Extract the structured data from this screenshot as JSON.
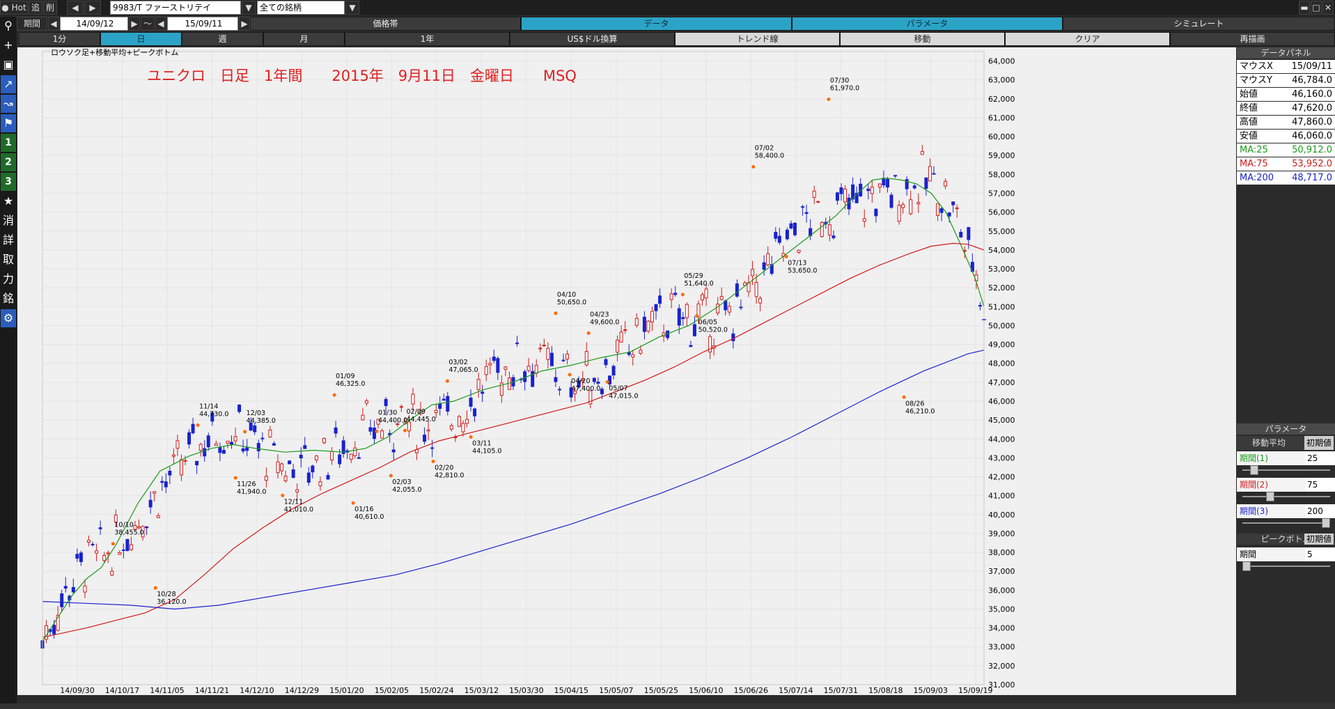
{
  "toolbar": {
    "hot_label": "Hot",
    "add_label": "追",
    "del_label": "削",
    "period_label": "期間",
    "ticker": "9983/T ファーストリテイ",
    "market": "全ての銘柄",
    "date_from": "14/09/12",
    "date_sep": "～",
    "date_to": "15/09/11",
    "tabs": [
      "価格帯",
      "データ",
      "パラメータ",
      "シミュレート"
    ],
    "timeframes": [
      "1分",
      "日",
      "週",
      "月",
      "1年",
      "US$ドル換算",
      "トレンド線",
      "移動",
      "クリア",
      "再描画"
    ]
  },
  "sidebar": {
    "items": [
      "+",
      "1",
      "2",
      "3",
      "★",
      "消",
      "詳",
      "取",
      "力",
      "銘"
    ]
  },
  "chart_data": {
    "type": "candlestick",
    "legend": "ロウソク足+移動平均+ピークボトム",
    "title": "ユニクロ　日足　1年間　　2015年　9月11日　金曜日　　MSQ",
    "ylim": [
      31000,
      64500
    ],
    "y_ticks": [
      "31,000",
      "32,000",
      "33,000",
      "34,000",
      "35,000",
      "36,000",
      "37,000",
      "38,000",
      "39,000",
      "40,000",
      "41,000",
      "42,000",
      "43,000",
      "44,000",
      "45,000",
      "46,000",
      "47,000",
      "48,000",
      "49,000",
      "50,000",
      "51,000",
      "52,000",
      "53,000",
      "54,000",
      "55,000",
      "56,000",
      "57,000",
      "58,000",
      "59,000",
      "60,000",
      "61,000",
      "62,000",
      "63,000",
      "64,000"
    ],
    "x_ticks": [
      "14/09/30",
      "14/10/17",
      "14/11/05",
      "14/11/21",
      "14/12/10",
      "14/12/29",
      "15/01/20",
      "15/02/05",
      "15/02/24",
      "15/03/12",
      "15/03/30",
      "15/04/15",
      "15/05/07",
      "15/05/25",
      "15/06/10",
      "15/06/26",
      "15/07/14",
      "15/07/31",
      "15/08/18",
      "15/09/03",
      "15/09/19"
    ],
    "ma": [
      {
        "name": "MA:25",
        "color": "#1a9a1a",
        "points": [
          [
            0,
            33300
          ],
          [
            20,
            34500
          ],
          [
            40,
            35700
          ],
          [
            60,
            36600
          ],
          [
            80,
            37200
          ],
          [
            100,
            38400
          ],
          [
            130,
            40600
          ],
          [
            160,
            42300
          ],
          [
            200,
            43100
          ],
          [
            230,
            43500
          ],
          [
            260,
            43700
          ],
          [
            290,
            43500
          ],
          [
            330,
            43300
          ],
          [
            370,
            43400
          ],
          [
            410,
            43300
          ],
          [
            440,
            43500
          ],
          [
            470,
            44100
          ],
          [
            500,
            45000
          ],
          [
            530,
            45800
          ],
          [
            560,
            46000
          ],
          [
            600,
            46600
          ],
          [
            640,
            47000
          ],
          [
            680,
            47600
          ],
          [
            720,
            47900
          ],
          [
            760,
            48300
          ],
          [
            800,
            48600
          ],
          [
            840,
            49400
          ],
          [
            880,
            50000
          ],
          [
            920,
            51000
          ],
          [
            960,
            52200
          ],
          [
            1000,
            53400
          ],
          [
            1040,
            54600
          ],
          [
            1080,
            55800
          ],
          [
            1110,
            57000
          ],
          [
            1130,
            57700
          ],
          [
            1150,
            57800
          ],
          [
            1170,
            57700
          ],
          [
            1190,
            57500
          ],
          [
            1210,
            57000
          ],
          [
            1230,
            56000
          ],
          [
            1250,
            54300
          ],
          [
            1270,
            52500
          ],
          [
            1282,
            51000
          ]
        ]
      },
      {
        "name": "MA:75",
        "color": "#d11a1a",
        "points": [
          [
            0,
            33500
          ],
          [
            60,
            34000
          ],
          [
            100,
            34400
          ],
          [
            140,
            34800
          ],
          [
            180,
            35500
          ],
          [
            220,
            36800
          ],
          [
            260,
            38200
          ],
          [
            300,
            39300
          ],
          [
            340,
            40300
          ],
          [
            380,
            41100
          ],
          [
            420,
            41800
          ],
          [
            460,
            42500
          ],
          [
            500,
            43300
          ],
          [
            540,
            43900
          ],
          [
            580,
            44300
          ],
          [
            620,
            44700
          ],
          [
            660,
            45100
          ],
          [
            700,
            45500
          ],
          [
            740,
            45900
          ],
          [
            780,
            46500
          ],
          [
            820,
            47100
          ],
          [
            860,
            47800
          ],
          [
            900,
            48600
          ],
          [
            940,
            49300
          ],
          [
            980,
            50100
          ],
          [
            1020,
            50900
          ],
          [
            1060,
            51700
          ],
          [
            1100,
            52500
          ],
          [
            1140,
            53200
          ],
          [
            1180,
            53800
          ],
          [
            1210,
            54200
          ],
          [
            1240,
            54350
          ],
          [
            1260,
            54300
          ],
          [
            1282,
            54000
          ]
        ]
      },
      {
        "name": "MA:200",
        "color": "#1a22cc",
        "points": [
          [
            0,
            35400
          ],
          [
            60,
            35300
          ],
          [
            120,
            35200
          ],
          [
            180,
            35000
          ],
          [
            240,
            35200
          ],
          [
            300,
            35600
          ],
          [
            360,
            36000
          ],
          [
            420,
            36400
          ],
          [
            480,
            36800
          ],
          [
            540,
            37400
          ],
          [
            600,
            38100
          ],
          [
            660,
            38800
          ],
          [
            720,
            39500
          ],
          [
            780,
            40300
          ],
          [
            840,
            41100
          ],
          [
            900,
            42000
          ],
          [
            960,
            43000
          ],
          [
            1020,
            44100
          ],
          [
            1080,
            45300
          ],
          [
            1140,
            46500
          ],
          [
            1200,
            47600
          ],
          [
            1240,
            48200
          ],
          [
            1260,
            48500
          ],
          [
            1282,
            48700
          ]
        ]
      }
    ],
    "peaks": [
      {
        "date": "10/10",
        "value": "38,455.0",
        "kind": "peak"
      },
      {
        "date": "10/28",
        "value": "36,120.0",
        "kind": "bottom"
      },
      {
        "date": "11/14",
        "value": "44,730.0",
        "kind": "peak"
      },
      {
        "date": "11/26",
        "value": "41,940.0",
        "kind": "bottom"
      },
      {
        "date": "12/03",
        "value": "44,385.0",
        "kind": "peak"
      },
      {
        "date": "12/11",
        "value": "41,010.0",
        "kind": "bottom"
      },
      {
        "date": "01/09",
        "value": "46,325.0",
        "kind": "peak"
      },
      {
        "date": "01/16",
        "value": "40,610.0",
        "kind": "bottom"
      },
      {
        "date": "01/30",
        "value": "44,400.0",
        "kind": "peak"
      },
      {
        "date": "02/03",
        "value": "42,055.0",
        "kind": "bottom"
      },
      {
        "date": "02/09",
        "value": "44,445.0",
        "kind": "peak"
      },
      {
        "date": "02/20",
        "value": "42,810.0",
        "kind": "bottom"
      },
      {
        "date": "03/02",
        "value": "47,065.0",
        "kind": "peak"
      },
      {
        "date": "03/11",
        "value": "44,105.0",
        "kind": "bottom"
      },
      {
        "date": "04/10",
        "value": "50,650.0",
        "kind": "peak"
      },
      {
        "date": "04/20",
        "value": "47,400.0",
        "kind": "bottom"
      },
      {
        "date": "04/23",
        "value": "49,600.0",
        "kind": "peak"
      },
      {
        "date": "05/07",
        "value": "47,015.0",
        "kind": "bottom"
      },
      {
        "date": "05/29",
        "value": "51,640.0",
        "kind": "peak"
      },
      {
        "date": "06/05",
        "value": "50,520.0",
        "kind": "bottom"
      },
      {
        "date": "07/02",
        "value": "58,400.0",
        "kind": "peak"
      },
      {
        "date": "07/13",
        "value": "53,650.0",
        "kind": "bottom"
      },
      {
        "date": "07/30",
        "value": "61,970.0",
        "kind": "peak"
      },
      {
        "date": "08/26",
        "value": "46,210.0",
        "kind": "bottom"
      }
    ]
  },
  "data_panel": {
    "title": "データパネル",
    "rows": [
      {
        "k": "マウスX",
        "v": "15/09/11"
      },
      {
        "k": "マウスY",
        "v": "46,784.0"
      },
      {
        "k": "始値",
        "v": "46,160.0"
      },
      {
        "k": "終値",
        "v": "47,620.0"
      },
      {
        "k": "高値",
        "v": "47,860.0"
      },
      {
        "k": "安値",
        "v": "46,060.0"
      },
      {
        "k": "MA:25",
        "v": "50,912.0",
        "color": "#1a9a1a"
      },
      {
        "k": "MA:75",
        "v": "53,952.0",
        "color": "#d11a1a"
      },
      {
        "k": "MA:200",
        "v": "48,717.0",
        "color": "#1a22cc"
      }
    ]
  },
  "params": {
    "title": "パラメータ",
    "ma_label": "移動平均",
    "reset_label": "初期値",
    "items": [
      {
        "k": "期間(1)",
        "v": "25",
        "level": 0.1,
        "color": "#1a9a1a"
      },
      {
        "k": "期間(2)",
        "v": "75",
        "level": 0.3,
        "color": "#d11a1a"
      },
      {
        "k": "期間(3)",
        "v": "200",
        "level": 1.0,
        "color": "#1a22cc"
      }
    ],
    "peak_title": "ピークボトム",
    "peak_period_label": "期間",
    "peak_period_value": "5",
    "peak_level": 0.0
  }
}
